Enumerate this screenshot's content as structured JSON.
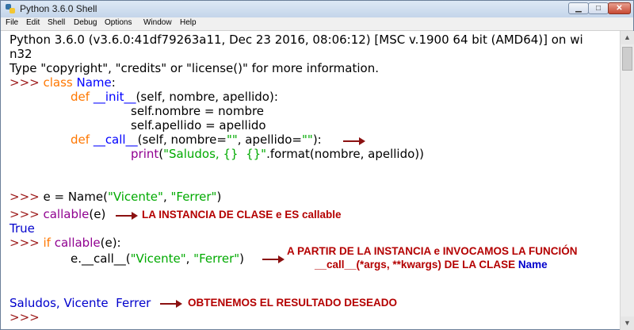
{
  "window": {
    "title": "Python 3.6.0 Shell",
    "buttons": {
      "minimize": "▁",
      "maximize": "□",
      "close": "✕"
    }
  },
  "menubar": [
    "File",
    "Edit",
    "Shell",
    "Debug",
    "Options",
    "Window",
    "Help"
  ],
  "shell": {
    "banner1": "Python 3.6.0 (v3.6.0:41df79263a11, Dec 23 2016, 08:06:12) [MSC v.1900 64 bit (AMD64)] on wi",
    "banner2": "n32",
    "banner3": "Type \"copyright\", \"credits\" or \"license()\" for more information.",
    "prompt": ">>> ",
    "l1_kw": "class",
    "l1_name": "Name",
    "l1_colon": ":",
    "l2_kw": "def",
    "l2_name": "__init__",
    "l2_rest": "(self, nombre, apellido):",
    "l3": "self.nombre = nombre",
    "l4": "self.apellido = apellido",
    "l5_kw": "def",
    "l5_name": "__call__",
    "l5_a": "(self, nombre=",
    "l5_s1": "\"\"",
    "l5_b": ", apellido=",
    "l5_s2": "\"\"",
    "l5_c": "):",
    "l6_fn": "print",
    "l6_a": "(",
    "l6_s": "\"Saludos, {}  {}\"",
    "l6_b": ".format(nombre, apellido))",
    "l7_a": "e = Name(",
    "l7_s1": "\"Vicente\"",
    "l7_b": ", ",
    "l7_s2": "\"Ferrer\"",
    "l7_c": ")",
    "l8_fn": "callable",
    "l8_rest": "(e)",
    "l9": "True",
    "l10_kw": "if",
    "l10_fn": "callable",
    "l10_rest": "(e):",
    "l11_a": "e.__call__(",
    "l11_s1": "\"Vicente\"",
    "l11_b": ", ",
    "l11_s2": "\"Ferrer\"",
    "l11_c": ")",
    "l12": "Saludos, Vicente  Ferrer",
    "l13": ">>>"
  },
  "annotations": {
    "a1": "LA INSTANCIA DE CLASE e ES callable",
    "a2_line1": "A PARTIR DE LA INSTANCIA e INVOCAMOS LA FUNCIÓN",
    "a2_line2": "__call__(*args, **kwargs) DE LA CLASE ",
    "a2_name": "Name",
    "a3": "OBTENEMOS EL RESULTADO DESEADO"
  },
  "colors": {
    "prompt": "#9d1b1b",
    "keyword": "#ff7700",
    "definition": "#0000ff",
    "builtin": "#900090",
    "string": "#00aa00",
    "output": "#0000cc",
    "annotation": "#b40000"
  }
}
